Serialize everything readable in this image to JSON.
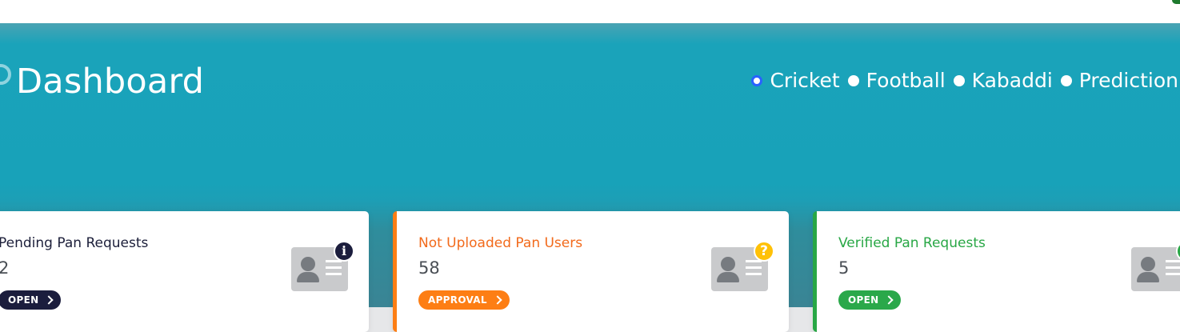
{
  "header": {
    "title": "Dashboard"
  },
  "sport_nav": {
    "items": [
      {
        "label": "Cricket",
        "selected": true
      },
      {
        "label": "Football",
        "selected": false
      },
      {
        "label": "Kabaddi",
        "selected": false
      },
      {
        "label": "Prediction",
        "selected": false
      }
    ]
  },
  "cards": [
    {
      "title": "Pending Pan Requests",
      "value": "2",
      "button_label": "OPEN",
      "badge_icon": "info-icon",
      "badge_glyph": "i",
      "accent": "#1b1d3d"
    },
    {
      "title": "Not Uploaded Pan Users",
      "value": "58",
      "button_label": "APPROVAL",
      "badge_icon": "question-icon",
      "badge_glyph": "?",
      "accent": "#fd7e14"
    },
    {
      "title": "Verified Pan Requests",
      "value": "5",
      "button_label": "OPEN",
      "badge_icon": "check-icon",
      "badge_glyph": "✓",
      "accent": "#28a745"
    }
  ],
  "colors": {
    "hero": "#18a2b9",
    "radio_selected": "#2962ff"
  }
}
